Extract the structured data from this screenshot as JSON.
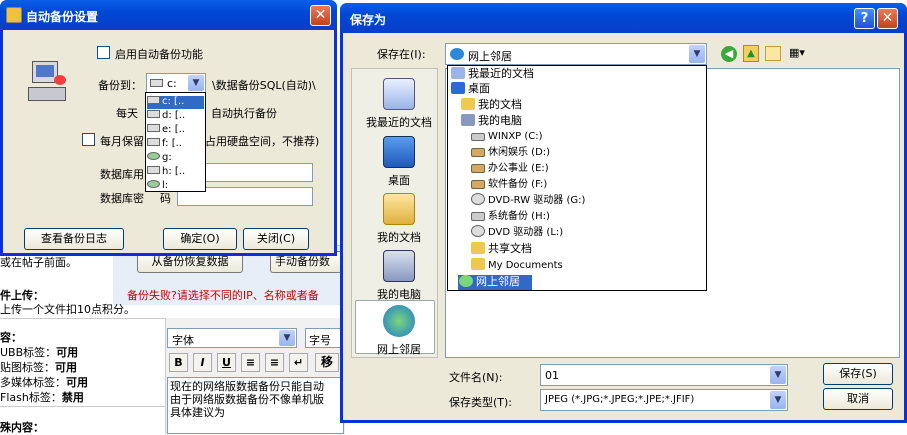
{
  "background": {
    "restore_button": "从备份恢复数据",
    "manual_button": "手动备份数",
    "error_text": "备份失败?请选择不同的IP、名称或者备",
    "frag1": "或在帖子前面。",
    "upload_title": "件上传：",
    "upload_desc": "上传一个文件扣10点积分。",
    "content_title": "容：",
    "ubb_label": "UBB标签：",
    "ubb_value": "可用",
    "paste_label": "贴图标签：",
    "paste_value": "可用",
    "media_label": "多媒体标签：",
    "media_value": "可用",
    "flash_label": "Flash标签：",
    "flash_value": "禁用",
    "special_title": "殊内容：",
    "font_select": "字体",
    "size_select": "字号",
    "editor_line1": "现在的网络版数据备份只能自动",
    "editor_line2": "由于网络版数据备份不像单机版",
    "editor_line3": "具体建议为"
  },
  "backup_dialog": {
    "title": "自动备份设置",
    "enable_label": "启用自动备份功能",
    "backup_to_label": "备份到：",
    "drive_value": "c:",
    "path_value": "\\数据备份SQL(自动)\\",
    "daily_label": "每天",
    "daily_suffix": "自动执行备份",
    "monthly_label": "每月保留",
    "monthly_suffix": "占用硬盘空间，不推荐)",
    "db_user_label": "数据库用",
    "db_pass_label": "数据库密",
    "db_pass_suffix": "码",
    "view_log_button": "查看备份日志",
    "ok_button": "确定(O)",
    "close_button": "关闭(C)",
    "drive_options": [
      "c: [..",
      "d: [..",
      "e: [..",
      "f: [..",
      "g:",
      "h: [..",
      "l:"
    ]
  },
  "save_dialog": {
    "title": "保存为",
    "save_in_label": "保存在(I):",
    "location_value": "网上邻居",
    "places": [
      "我最近的文档",
      "桌面",
      "我的文档",
      "我的电脑",
      "网上邻居"
    ],
    "tree": [
      "我最近的文档",
      "桌面",
      "我的文档",
      "我的电脑",
      "WINXP (C:)",
      "休闲娱乐 (D:)",
      "办公事业 (E:)",
      "软件备份 (F:)",
      "DVD-RW 驱动器 (G:)",
      "系统备份 (H:)",
      "DVD 驱动器 (L:)",
      "共享文档",
      "My Documents",
      "网上邻居"
    ],
    "filename_label": "文件名(N):",
    "filename_value": "01",
    "filetype_label": "保存类型(T):",
    "filetype_value": "JPEG (*.JPG;*.JPEG;*.JPE;*.JFIF)",
    "save_button": "保存(S)",
    "cancel_button": "取消"
  },
  "colors": {
    "xp_blue": "#0047d5",
    "dialog_bg": "#ece9d8",
    "selection": "#316ac5",
    "error_red": "#cc0000"
  }
}
